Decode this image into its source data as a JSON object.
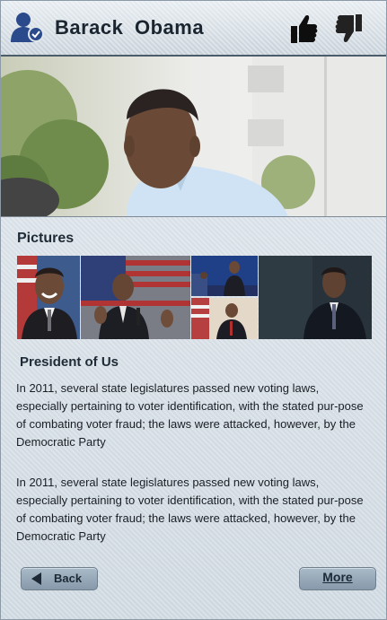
{
  "header": {
    "title": "Barack  Obama",
    "profile_icon": "verified-user-icon",
    "like_icon": "thumbs-up-icon",
    "dislike_icon": "thumbs-down-icon"
  },
  "pictures": {
    "title": "Pictures",
    "count": 5
  },
  "article": {
    "title": "President of Us",
    "paragraphs": [
      "In 2011, several state legislatures passed new voting laws, especially pertaining to voter identification, with the stated pur-pose of combating voter fraud; the laws were attacked, however, by the Democratic Party",
      "In 2011, several state legislatures passed new voting laws, especially pertaining to voter identification, with the stated pur-pose of combating voter fraud; the laws were attacked, however, by the Democratic Party"
    ]
  },
  "buttons": {
    "back_label": "Back",
    "more_label": "More"
  },
  "colors": {
    "accent": "#2f4f8f",
    "header_border": "#4b5d6b",
    "button_fill": "#98aabb"
  }
}
